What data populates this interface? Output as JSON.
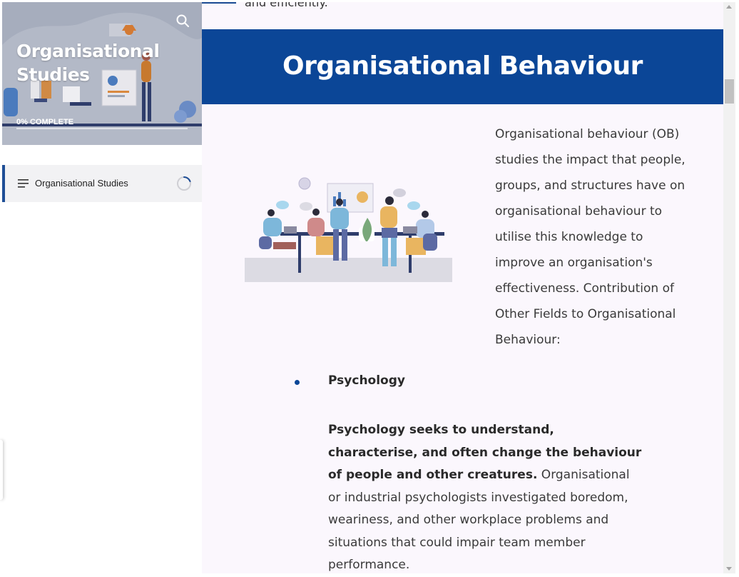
{
  "sidebar": {
    "course_title": "Organisational Studies",
    "progress_label": "0% COMPLETE",
    "progress": 0,
    "items": [
      {
        "label": "Organisational Studies",
        "progress": 0.1
      }
    ]
  },
  "main": {
    "cutoff_text": "and efficiently.",
    "section_title": "Organisational Behaviour",
    "intro": "Organisational behaviour (OB) studies the impact that people, groups, and structures have on organisational behaviour to utilise this knowledge to improve an organisation's effectiveness. Contribution of Other Fields to Organisational Behaviour:",
    "bullets": [
      {
        "heading": "Psychology",
        "bold_text": "Psychology seeks to understand, characterise, and often change the behaviour of people and other creatures.",
        "body_text": " Organisational or industrial psychologists investigated boredom, weariness, and other workplace problems and situations that could impair team member performance."
      }
    ]
  },
  "colors": {
    "brand_blue": "#0b4697",
    "accent_blue": "#1f4e96",
    "content_bg": "#fbf7fd"
  },
  "icons": [
    "search-icon",
    "menu-lines-icon",
    "progress-ring-icon"
  ]
}
